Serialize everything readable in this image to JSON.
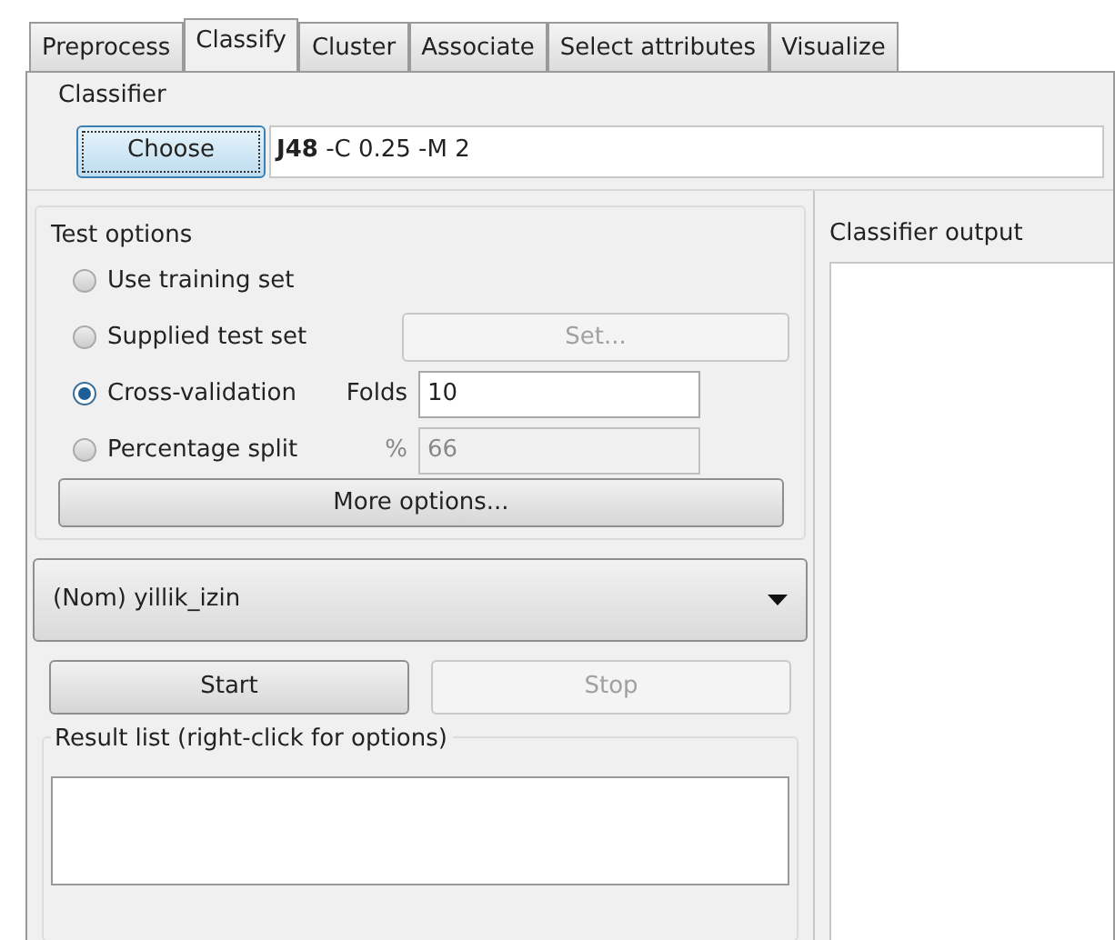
{
  "tabs": [
    {
      "label": "Preprocess",
      "selected": false
    },
    {
      "label": "Classify",
      "selected": true
    },
    {
      "label": "Cluster",
      "selected": false
    },
    {
      "label": "Associate",
      "selected": false
    },
    {
      "label": "Select attributes",
      "selected": false
    },
    {
      "label": "Visualize",
      "selected": false
    }
  ],
  "classifier": {
    "title": "Classifier",
    "button": "Choose",
    "command": "**J48** -C 0.25 -M 2"
  },
  "test_options": {
    "title": "Test options",
    "options": [
      {
        "kind": "plain",
        "label": "Use training set",
        "selected": false
      },
      {
        "kind": "button",
        "label": "Supplied test set",
        "selected": false,
        "button": "Set...",
        "disabled": true
      },
      {
        "kind": "field",
        "label": "Cross-validation",
        "selected": true,
        "field_label": "Folds",
        "value": "10",
        "disabled": false
      },
      {
        "kind": "field",
        "label": "Percentage split",
        "selected": false,
        "field_label": "%",
        "value": "66",
        "disabled": true
      }
    ],
    "more_button": "More options..."
  },
  "class_attribute": "(Nom) yillik_izin",
  "start_button": {
    "label": "Start",
    "disabled": false
  },
  "stop_button": {
    "label": "Stop",
    "disabled": true
  },
  "result_list": {
    "title": "Result list (right-click for options)"
  },
  "output": {
    "title": "Classifier output"
  }
}
